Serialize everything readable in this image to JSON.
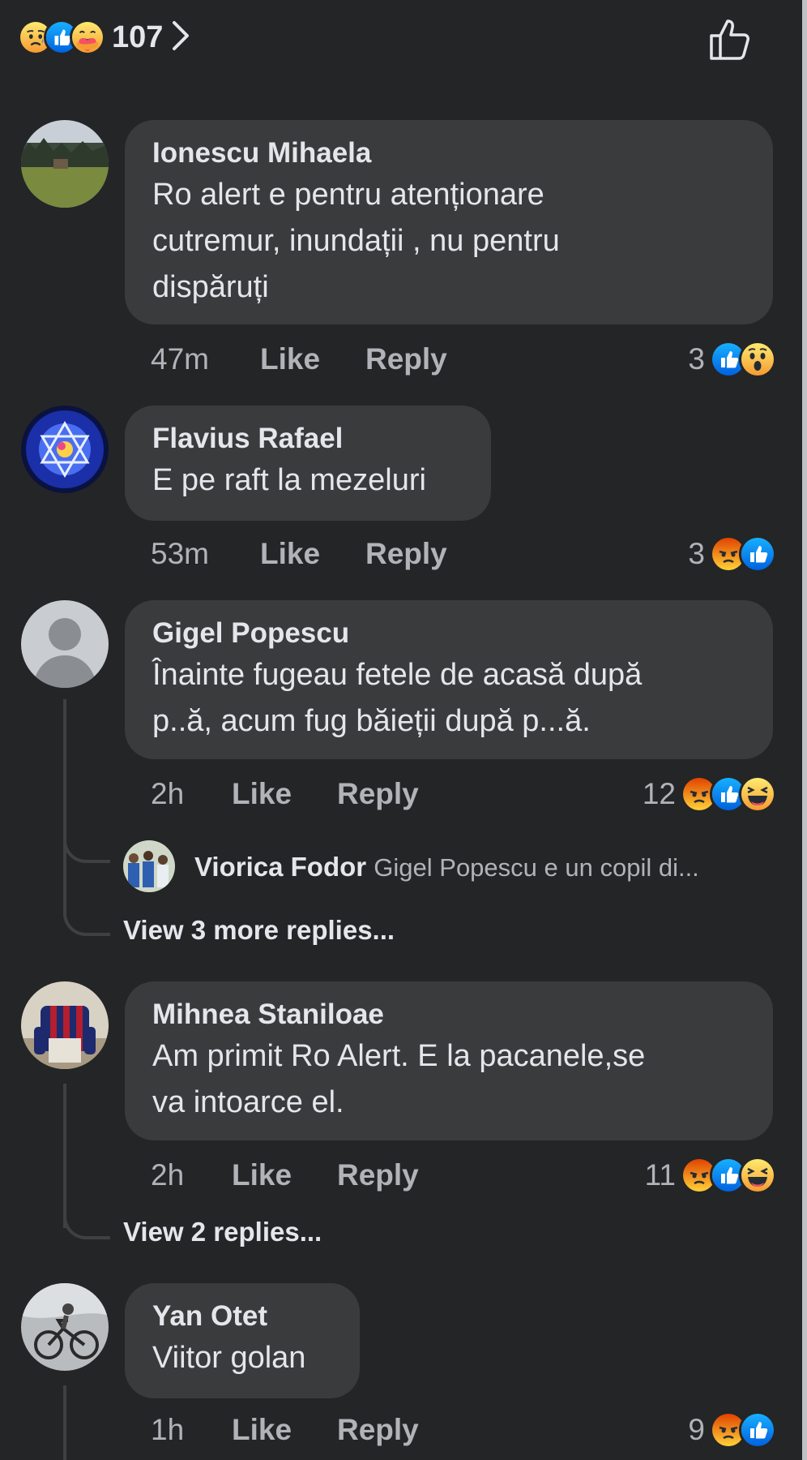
{
  "header": {
    "reactions": [
      "sad",
      "like",
      "care"
    ],
    "total": "107",
    "chevron_icon": "chevron-right-icon",
    "like_icon": "thumbs-up-outline-icon"
  },
  "comments": [
    {
      "author": "Ionescu Mihaela",
      "text": "Ro alert e pentru atenționare\ncutremur, inundații , nu pentru\ndispăruți",
      "time": "47m",
      "like": "Like",
      "reply": "Reply",
      "reaction_count": "3",
      "reactions": [
        "like",
        "wow"
      ]
    },
    {
      "author": "Flavius Rafael",
      "text": "E pe raft la mezeluri",
      "time": "53m",
      "like": "Like",
      "reply": "Reply",
      "reaction_count": "3",
      "reactions": [
        "angry",
        "like"
      ]
    },
    {
      "author": "Gigel Popescu",
      "text": "Înainte fugeau fetele de acasă după\np..ă, acum fug băieții după p...ă.",
      "time": "2h",
      "like": "Like",
      "reply": "Reply",
      "reaction_count": "12",
      "reactions": [
        "angry",
        "like",
        "haha"
      ],
      "reply_preview": {
        "author": "Viorica Fodor",
        "text": "Gigel Popescu e un copil di..."
      },
      "view_more": "View 3 more replies..."
    },
    {
      "author": "Mihnea Staniloae",
      "text": "Am primit Ro Alert. E la pacanele,se\nva intoarce el.",
      "time": "2h",
      "like": "Like",
      "reply": "Reply",
      "reaction_count": "11",
      "reactions": [
        "angry",
        "like",
        "haha"
      ],
      "view_more": "View 2 replies..."
    },
    {
      "author": "Yan Otet",
      "text": "Viitor golan",
      "time": "1h",
      "like": "Like",
      "reply": "Reply",
      "reaction_count": "9",
      "reactions": [
        "angry",
        "like"
      ]
    }
  ],
  "colors": {
    "background": "#242526",
    "bubble": "#3a3b3c",
    "like_blue": "#1877f2",
    "angry_orange": "#e9710f",
    "emoji_yellow": "#f7b125"
  }
}
